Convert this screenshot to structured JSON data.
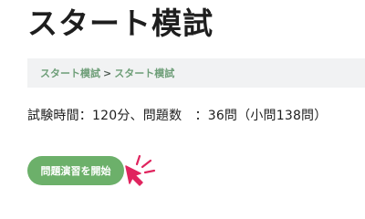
{
  "page": {
    "title": "スタート模試"
  },
  "breadcrumb": {
    "items": [
      "スタート模試",
      "スタート模試"
    ],
    "separator": ">"
  },
  "exam_info": {
    "text": "試験時間：120分、問題数　：36問（小問138問）"
  },
  "start_button": {
    "label": "問題演習を開始"
  },
  "colors": {
    "accent_green": "#6cb06a",
    "breadcrumb_link": "#6e9e78",
    "pointer_pink": "#e0245e"
  },
  "icons": {
    "pointer": "click-pointer-icon"
  }
}
